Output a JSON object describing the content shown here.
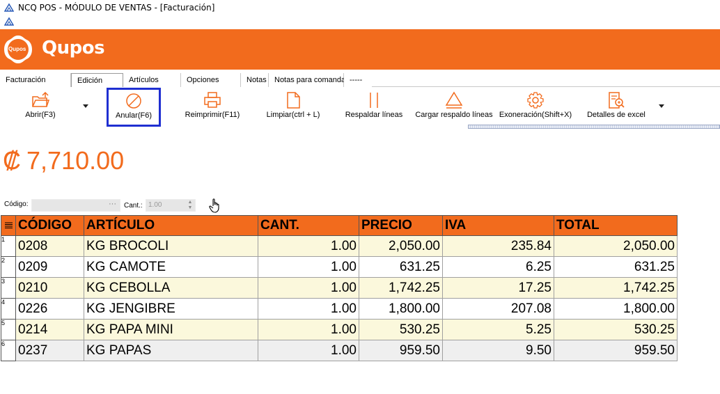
{
  "window": {
    "title": "NCQ POS - MÓDULO DE VENTAS - [Facturación]"
  },
  "brand": {
    "badge_text": "Qupos",
    "name": "Qupos",
    "color": "#f26b1d"
  },
  "tabs": [
    {
      "label": "Facturación"
    },
    {
      "label": "Edición"
    },
    {
      "label": "Artículos"
    },
    {
      "label": "Opciones"
    },
    {
      "label": "Notas"
    },
    {
      "label": "Notas para comanda"
    },
    {
      "label": "-----"
    }
  ],
  "toolbar": {
    "open_label": "Abrir(F3)",
    "void_label": "Anular(F6)",
    "reprint_label": "Reimprimir(F11)",
    "clear_label": "Limpiar(ctrl + L)",
    "backup_label": "Respaldar líneas",
    "load_backup_label": "Cargar respaldo líneas",
    "exoneration_label": "Exoneración(Shift+X)",
    "excel_label": "Detalles de excel"
  },
  "totals": {
    "currency_symbol": "₡",
    "amount": "7,710.00"
  },
  "entry": {
    "code_label": "Código:",
    "code_value": "",
    "code_more": "···",
    "qty_label": "Cant.:",
    "qty_value": "1.00"
  },
  "table": {
    "headers": [
      "CÓDIGO",
      "ARTÍCULO",
      "CANT.",
      "PRECIO",
      "IVA",
      "TOTAL"
    ],
    "rows": [
      {
        "n": "1",
        "codigo": "0208",
        "articulo": "KG BROCOLI",
        "cant": "1.00",
        "precio": "2,050.00",
        "iva": "235.84",
        "total": "2,050.00"
      },
      {
        "n": "2",
        "codigo": "0209",
        "articulo": "KG CAMOTE",
        "cant": "1.00",
        "precio": "631.25",
        "iva": "6.25",
        "total": "631.25"
      },
      {
        "n": "3",
        "codigo": "0210",
        "articulo": "KG CEBOLLA",
        "cant": "1.00",
        "precio": "1,742.25",
        "iva": "17.25",
        "total": "1,742.25"
      },
      {
        "n": "4",
        "codigo": "0226",
        "articulo": "KG JENGIBRE",
        "cant": "1.00",
        "precio": "1,800.00",
        "iva": "207.08",
        "total": "1,800.00"
      },
      {
        "n": "5",
        "codigo": "0214",
        "articulo": "KG PAPA MINI",
        "cant": "1.00",
        "precio": "530.25",
        "iva": "5.25",
        "total": "530.25"
      },
      {
        "n": "6",
        "codigo": "0237",
        "articulo": "KG PAPAS",
        "cant": "1.00",
        "precio": "959.50",
        "iva": "9.50",
        "total": "959.50"
      }
    ]
  }
}
